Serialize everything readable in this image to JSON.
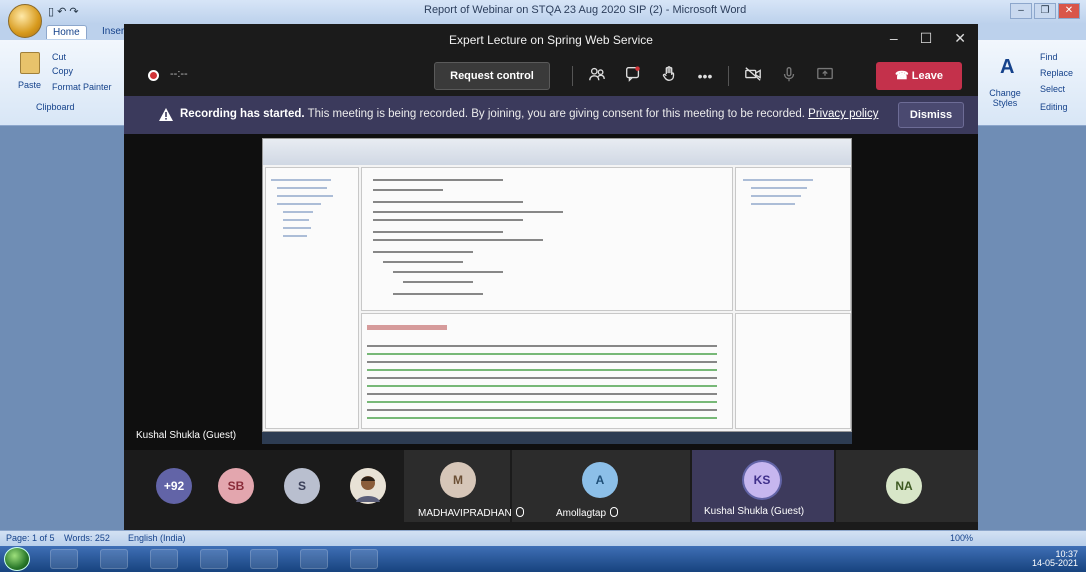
{
  "word": {
    "window_title": "Report of Webinar on STQA 23 Aug 2020 SIP (2) - Microsoft Word",
    "tabs": [
      "Home",
      "Insert"
    ],
    "clipboard": {
      "paste": "Paste",
      "cut": "Cut",
      "copy": "Copy",
      "format_painter": "Format Painter",
      "group": "Clipboard"
    },
    "editing": {
      "find": "Find",
      "replace": "Replace",
      "select": "Select",
      "change_styles": "Change Styles",
      "group": "Editing"
    },
    "status": {
      "page": "Page: 1 of 5",
      "words": "Words: 252",
      "language": "English (India)",
      "zoom": "100%"
    },
    "clock": {
      "time": "10:37",
      "date": "14-05-2021"
    }
  },
  "teams": {
    "meeting_title": "Expert Lecture on Spring Web Service",
    "timer": "--:--",
    "request_control": "Request control",
    "leave": "Leave",
    "banner": {
      "bold": "Recording has started.",
      "text": "This meeting is being recorded. By joining, you are giving consent for this meeting to be recorded.",
      "link": "Privacy policy",
      "dismiss": "Dismiss"
    },
    "presenter": "Kushal Shukla (Guest)",
    "participants": [
      {
        "initials": "+92",
        "color": "#6264a7"
      },
      {
        "initials": "SB",
        "color": "#e3a6ae",
        "text_color": "#8a2c3a"
      },
      {
        "initials": "S",
        "color": "#b9bfcf",
        "text_color": "#3a3f58"
      },
      {
        "initials": "",
        "color": "#7a5c3e",
        "photo": true
      },
      {
        "initials": "M",
        "color": "#d6c6b8",
        "text_color": "#6b4f35",
        "name": "MADHAVIPRADHAN"
      },
      {
        "initials": "A",
        "color": "#8cbfe8",
        "text_color": "#1f4f78",
        "name": "Amollagtap"
      },
      {
        "initials": "KS",
        "color": "#c6b6ef",
        "text_color": "#3f2f8a",
        "name": "Kushal Shukla (Guest)",
        "highlight": true
      },
      {
        "initials": "NA",
        "color": "#d8e6c8",
        "text_color": "#3e5a22"
      }
    ]
  }
}
